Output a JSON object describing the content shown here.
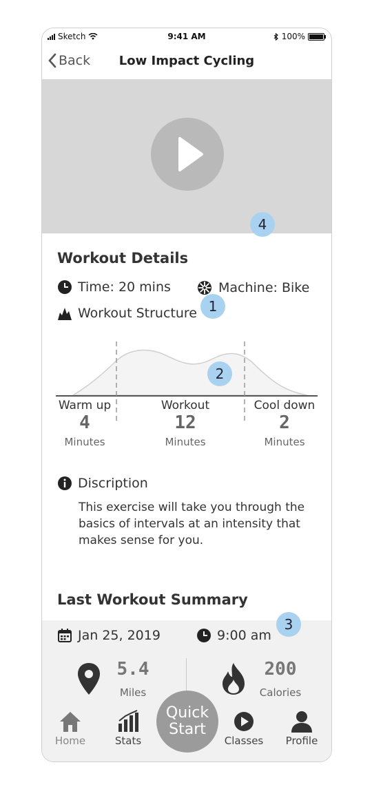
{
  "status_bar": {
    "carrier": "Sketch",
    "time": "9:41 AM",
    "battery": "100%"
  },
  "nav": {
    "back_label": "Back",
    "title": "Low Impact Cycling"
  },
  "badges": {
    "video": "4",
    "details": "1",
    "chart": "2",
    "summary": "3"
  },
  "details": {
    "heading": "Workout Details",
    "time": "Time: 20 mins",
    "machine": "Machine: Bike",
    "structure": "Workout Structure"
  },
  "structure": {
    "phases": [
      {
        "label": "Warm up",
        "value": "4",
        "unit": "Minutes"
      },
      {
        "label": "Workout",
        "value": "12",
        "unit": "Minutes"
      },
      {
        "label": "Cool down",
        "value": "2",
        "unit": "Minutes"
      }
    ]
  },
  "description": {
    "label": "Discription",
    "line1": "This exercise will take you through the",
    "line2": "basics of intervals at an intensity that",
    "line3": "makes sense for you."
  },
  "summary": {
    "heading": "Last Workout Summary",
    "date": "Jan 25, 2019",
    "time": "9:00 am",
    "distance": "5.4",
    "distance_unit": "Miles",
    "calories": "200",
    "calories_unit": "Calories"
  },
  "tabbar": {
    "home": "Home",
    "stats": "Stats",
    "quick1": "Quick",
    "quick2": "Start",
    "classes": "Classes",
    "profile": "Profile"
  },
  "colors": {
    "badge": "#a9d2f0",
    "video_bg": "#d7d7d7",
    "play": "#b9b9b9",
    "quick_start": "#9b9b9b",
    "panel": "#f1f1f1"
  }
}
